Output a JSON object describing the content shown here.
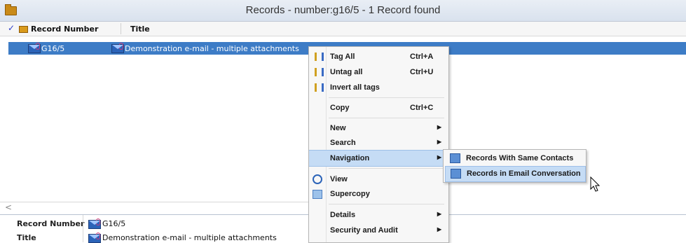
{
  "window": {
    "title": "Records - number:g16/5 - 1 Record found"
  },
  "header": {
    "check_mark": "✓",
    "col_record_number": "Record Number",
    "col_title": "Title"
  },
  "rows": [
    {
      "record_number": "G16/5",
      "title": "Demonstration e-mail - multiple attachments"
    }
  ],
  "scroll_arrow": "<",
  "properties": [
    {
      "label": "Record Number",
      "value": "G16/5"
    },
    {
      "label": "Title",
      "value": "Demonstration e-mail - multiple attachments"
    }
  ],
  "context_menu": {
    "tag_all": "Tag All",
    "tag_all_sc": "Ctrl+A",
    "untag_all": "Untag all",
    "untag_all_sc": "Ctrl+U",
    "invert_tags": "Invert all tags",
    "copy": "Copy",
    "copy_sc": "Ctrl+C",
    "new": "New",
    "search": "Search",
    "navigation": "Navigation",
    "view": "View",
    "supercopy": "Supercopy",
    "details": "Details",
    "security_audit": "Security and Audit"
  },
  "submenu": {
    "same_contacts": "Records With Same Contacts",
    "email_conversation": "Records in Email Conversation"
  },
  "colors": {
    "selection": "#3d7cc6",
    "menu_highlight": "#c5dcf5"
  }
}
